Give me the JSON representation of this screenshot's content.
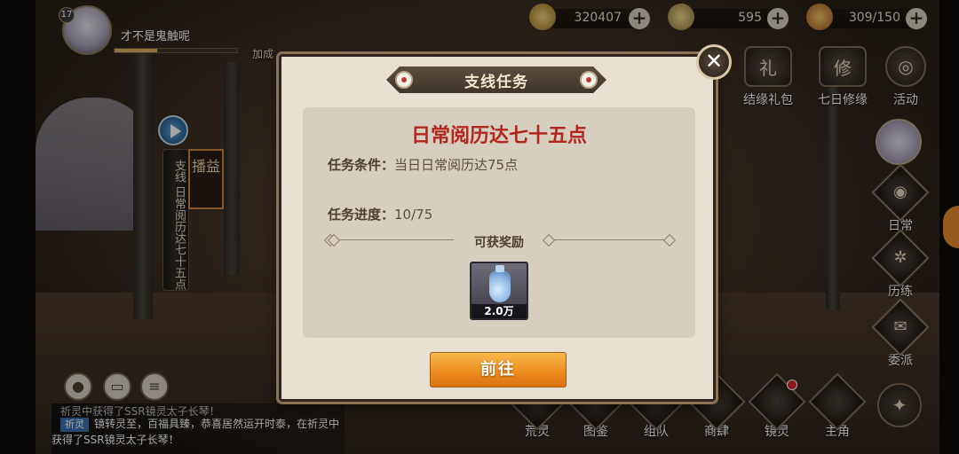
{
  "player": {
    "level": "17",
    "name": "才不是鬼触呢",
    "xp_progress": 0.35
  },
  "resources": [
    {
      "icon": "coin-icon",
      "value": "320407"
    },
    {
      "icon": "jade-icon",
      "value": "595"
    },
    {
      "icon": "stamina-icon",
      "value": "309/150"
    }
  ],
  "top_partial_label": "加成",
  "right_menu": {
    "bond_gift": "结缘礼包",
    "seven_day": "七日修缘",
    "activity": "活动",
    "daily": "日常",
    "training": "历练",
    "commission": "委派"
  },
  "left_panel": {
    "vertical_title": "支线 日常阅历达七十五点",
    "sign_text": "播益"
  },
  "chat": {
    "line1": "祈灵中获得了SSR镜灵太子长琴！",
    "tag": "祈灵",
    "line2": "镜转灵至，百福具臻，恭喜居然运开时泰，在祈灵中获得了SSR镜灵太子长琴！"
  },
  "bottom_nav": {
    "wilderness": "荒灵",
    "atlas": "图鉴",
    "team": "组队",
    "shop": "商肆",
    "mirror_spirit": "镜灵",
    "protagonist": "主角"
  },
  "dialog": {
    "title": "支线任务",
    "task_title": "日常阅历达七十五点",
    "condition_label": "任务条件：",
    "condition_value": "当日日常阅历达75点",
    "progress_label": "任务进度：",
    "progress_value": "10/75",
    "reward_label": "可获奖励",
    "reward_item": {
      "icon": "potion-icon",
      "quantity": "2.0万"
    },
    "go_button": "前往"
  },
  "colors": {
    "accent_red": "#b3261e",
    "button_orange": "#ec8a1c",
    "dialog_bg": "#e8e1d3",
    "inner_bg": "#d6cebf"
  }
}
